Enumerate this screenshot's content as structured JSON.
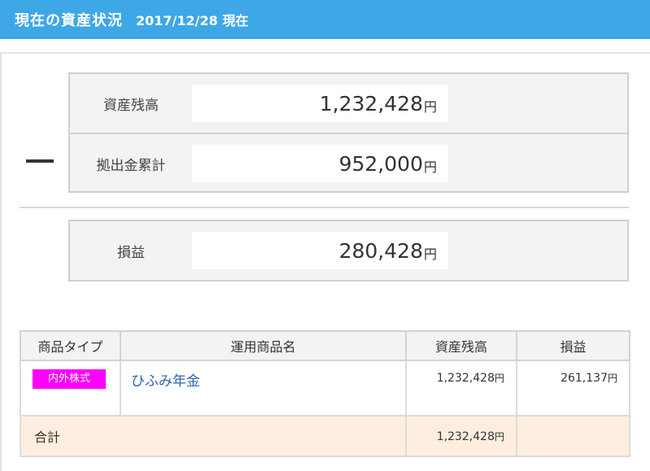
{
  "header": {
    "title": "現在の資産状況",
    "date": "2017/12/28 現在"
  },
  "summary": {
    "balance": {
      "label": "資産残高",
      "value": "1,232,428",
      "unit": "円"
    },
    "contributions": {
      "label": "拠出金累計",
      "value": "952,000",
      "unit": "円"
    },
    "operator": "—",
    "profit": {
      "label": "損益",
      "value": "280,428",
      "unit": "円"
    }
  },
  "table": {
    "headers": [
      "商品タイプ",
      "運用商品名",
      "資産残高",
      "損益"
    ],
    "rows": [
      {
        "type": "内外株式",
        "name": "ひふみ年金",
        "balance": "1,232,428",
        "profit": "261,137",
        "unit": "円"
      }
    ],
    "total": {
      "label": "合計",
      "balance": "1,232,428",
      "unit": "円"
    }
  },
  "colors": {
    "header_bg": "#3ea7e6",
    "badge_bg": "#ff00ff",
    "total_bg": "#fdeee0",
    "link": "#2c66b5"
  }
}
